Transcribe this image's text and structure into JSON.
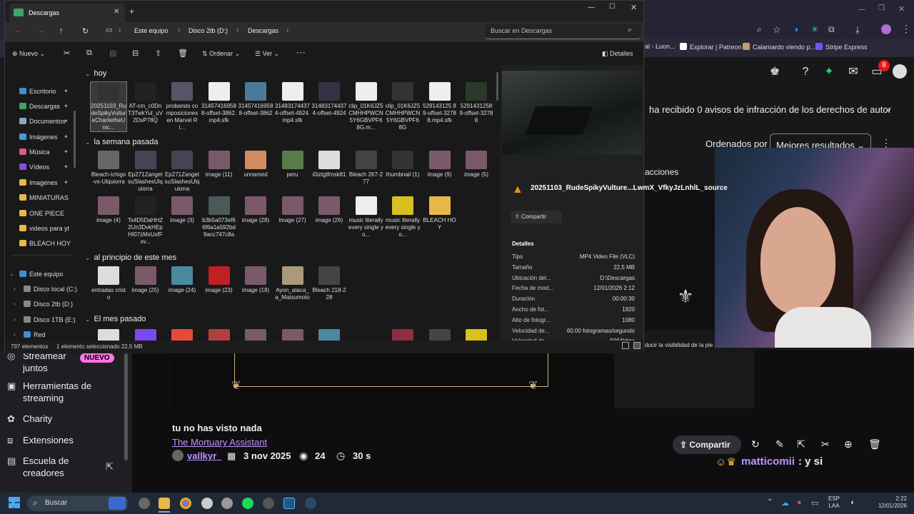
{
  "browser": {
    "bookmarks": [
      "al - Luon...",
      "Explorar | Patreon",
      "Calamardo viendo p...",
      "Stripe Express"
    ],
    "notification_count": "8"
  },
  "twitch": {
    "notice": "ha recibido 0 avisos de infracción de los derechos de autor",
    "sort_label": "Ordenados por",
    "sort_value": "Mejores resultados",
    "acciones": "acciones",
    "sidebar": [
      {
        "label": "Streamear juntos",
        "badge": "NUEVO"
      },
      {
        "label": "Herramientas de streaming"
      },
      {
        "label": "Charity"
      },
      {
        "label": "Extensiones"
      },
      {
        "label": "Escuela de creadores"
      }
    ],
    "overlay_text": "ducir la visibilidad de la pie",
    "clip_title": "tu no has visto nada",
    "game": "The Mortuary Assistant",
    "author": "vallkyr_",
    "date": "3 nov 2025",
    "views": "24",
    "duration": "30 s",
    "share_label": "Compartir",
    "chat_user": "matticomii",
    "chat_msg": ": y si"
  },
  "explorer": {
    "tab_title": "Descargas",
    "breadcrumb": [
      "Este equipo",
      "Disco 2tb (D:)",
      "Descargas"
    ],
    "search_placeholder": "Buscar en Descargas",
    "cmd": {
      "new": "Nuevo",
      "sort": "Ordenar",
      "view": "Ver",
      "details": "Detalles"
    },
    "nav": [
      {
        "label": "Escritorio",
        "color": "#3a8fd8",
        "pinned": true
      },
      {
        "label": "Descargas",
        "color": "#3aa860",
        "pinned": true
      },
      {
        "label": "Documentos",
        "color": "#8fa6c2",
        "pinned": true
      },
      {
        "label": "Imágenes",
        "color": "#3a9fd8",
        "pinned": true
      },
      {
        "label": "Música",
        "color": "#e0548a",
        "pinned": true
      },
      {
        "label": "Vídeos",
        "color": "#8a4fd8",
        "pinned": true
      },
      {
        "label": "Imagenes",
        "color": "#e8b84a",
        "pinned": true
      },
      {
        "label": "MINIATURAS",
        "color": "#e8b84a",
        "pinned": false
      },
      {
        "label": "ONE PIECE",
        "color": "#e8b84a",
        "pinned": false
      },
      {
        "label": "videos para yt",
        "color": "#e8b84a",
        "pinned": false
      },
      {
        "label": "BLEACH HOY",
        "color": "#e8b84a",
        "pinned": false
      },
      {
        "label": "Este equipo",
        "color": "#3a8fd8",
        "pinned": false
      },
      {
        "label": "Disco local (C:)",
        "color": "#888888",
        "pinned": false
      },
      {
        "label": "Disco 2tb (D:)",
        "color": "#888888",
        "pinned": false
      },
      {
        "label": "Disco 1TB (E:)",
        "color": "#888888",
        "pinned": false
      },
      {
        "label": "Red",
        "color": "#3a8fd8",
        "pinned": false
      }
    ],
    "groups": [
      {
        "title": "hoy",
        "files": [
          {
            "name": "20251103_RudeSpikyVultureCharlietheUnic...",
            "color": "#333"
          },
          {
            "name": "AT-cm_c0DnT3TwkYul_uV2DsP78Q",
            "color": "#222"
          },
          {
            "name": "probando composiciones en Marvel Ri...",
            "color": "#556"
          },
          {
            "name": "314574169588-offset-3862.mp4.sfk",
            "color": "#eee"
          },
          {
            "name": "314574169588-offset-3862",
            "color": "#4a7a9a"
          },
          {
            "name": "314831744374-offset-4924.mp4.sfk",
            "color": "#eee"
          },
          {
            "name": "314831744374-offset-4924",
            "color": "#334"
          },
          {
            "name": "clip_01K6JZ5CMHHPWCN5Y6GBVPF68G.m...",
            "color": "#eee"
          },
          {
            "name": "clip_01K6JZ5CMHHPWCN5Y6GBVPF68G",
            "color": "#333"
          },
          {
            "name": "529143125 89-offset-32788.mp4.sfk",
            "color": "#eee"
          },
          {
            "name": "5291431258 9-offset-32788",
            "color": "#2a3a2a"
          }
        ]
      },
      {
        "title": "la semana pasada",
        "files": [
          {
            "name": "Bleach-Ichigo-vs-Ulquiorra",
            "color": "#666"
          },
          {
            "name": "Ep271ZangetsuSlashesUlquiorra",
            "color": "#445"
          },
          {
            "name": "Ep271ZangetsuSlashesUlquiorra",
            "color": "#445"
          },
          {
            "name": "image (11)",
            "color": "#7a5a6a"
          },
          {
            "name": "unnamed",
            "color": "#d28a60"
          },
          {
            "name": "peru",
            "color": "#5a7a4a"
          },
          {
            "name": "i0iztgtfmsk81",
            "color": "#ddd"
          },
          {
            "name": "Bleach 267-277",
            "color": "#444"
          },
          {
            "name": "thumbnail (1)",
            "color": "#333"
          },
          {
            "name": "image (9)",
            "color": "#7a5a6a"
          },
          {
            "name": "image (5)",
            "color": "#7a5a6a"
          },
          {
            "name": "image (4)",
            "color": "#7a5a6a"
          },
          {
            "name": "Ts4D5DaHHZ2Un3DvkHEpHI07zMsUxfFxv...",
            "color": "#222"
          },
          {
            "name": "image (3)",
            "color": "#7a5a6a"
          },
          {
            "name": "b3b5a073ef66f6a1a592bd9acc747c8a",
            "color": "#4a5a5a"
          },
          {
            "name": "image (28)",
            "color": "#7a5a6a"
          },
          {
            "name": "image (27)",
            "color": "#7a5a6a"
          },
          {
            "name": "image (26)",
            "color": "#7a5a6a"
          },
          {
            "name": "music literally every single yo...",
            "color": "#eee"
          },
          {
            "name": "music literally every single yo...",
            "color": "#d8c020"
          },
          {
            "name": "BLEACH HOY",
            "color": "#e8b84a"
          }
        ]
      },
      {
        "title": "al principio de este mes",
        "files": [
          {
            "name": "entradas cristo",
            "color": "#ddd"
          },
          {
            "name": "image (25)",
            "color": "#7a5a6a"
          },
          {
            "name": "image (24)",
            "color": "#4a8aa0"
          },
          {
            "name": "image (23)",
            "color": "#c02020"
          },
          {
            "name": "image (18)",
            "color": "#7a5a6a"
          },
          {
            "name": "Ayon_ataca_a_Matsumoto",
            "color": "#aa9a7a"
          },
          {
            "name": "Bleach 218-228",
            "color": "#444"
          }
        ]
      },
      {
        "title": "El mes pasado",
        "files": []
      }
    ],
    "details": {
      "filename": "20251103_RudeSpikyVulture...LwmX_VfkyJzLnhlL_source",
      "share": "Compartir",
      "section": "Detalles",
      "rows": [
        [
          "Tipo",
          "MP4 Video File (VLC)"
        ],
        [
          "Tamaño",
          "22,5 MB"
        ],
        [
          "Ubicación del...",
          "D:\\Descargas"
        ],
        [
          "Fecha de mod...",
          "12/01/2026 2:12"
        ],
        [
          "Duración",
          "00:00:30"
        ],
        [
          "Ancho de fot...",
          "1920"
        ],
        [
          "Alto de fotogr...",
          "1080"
        ],
        [
          "Velocidad de...",
          "60.00 fotogramas/segundo"
        ],
        [
          "Velocidad de...",
          "5994kbps"
        ]
      ]
    },
    "status": {
      "count": "797 elementos",
      "selection": "1 elemento seleccionado  22,5 MB"
    }
  },
  "taskbar": {
    "search": "Buscar",
    "lang": "ESP",
    "region": "LAA",
    "time": "2:22",
    "date": "12/01/2026"
  }
}
